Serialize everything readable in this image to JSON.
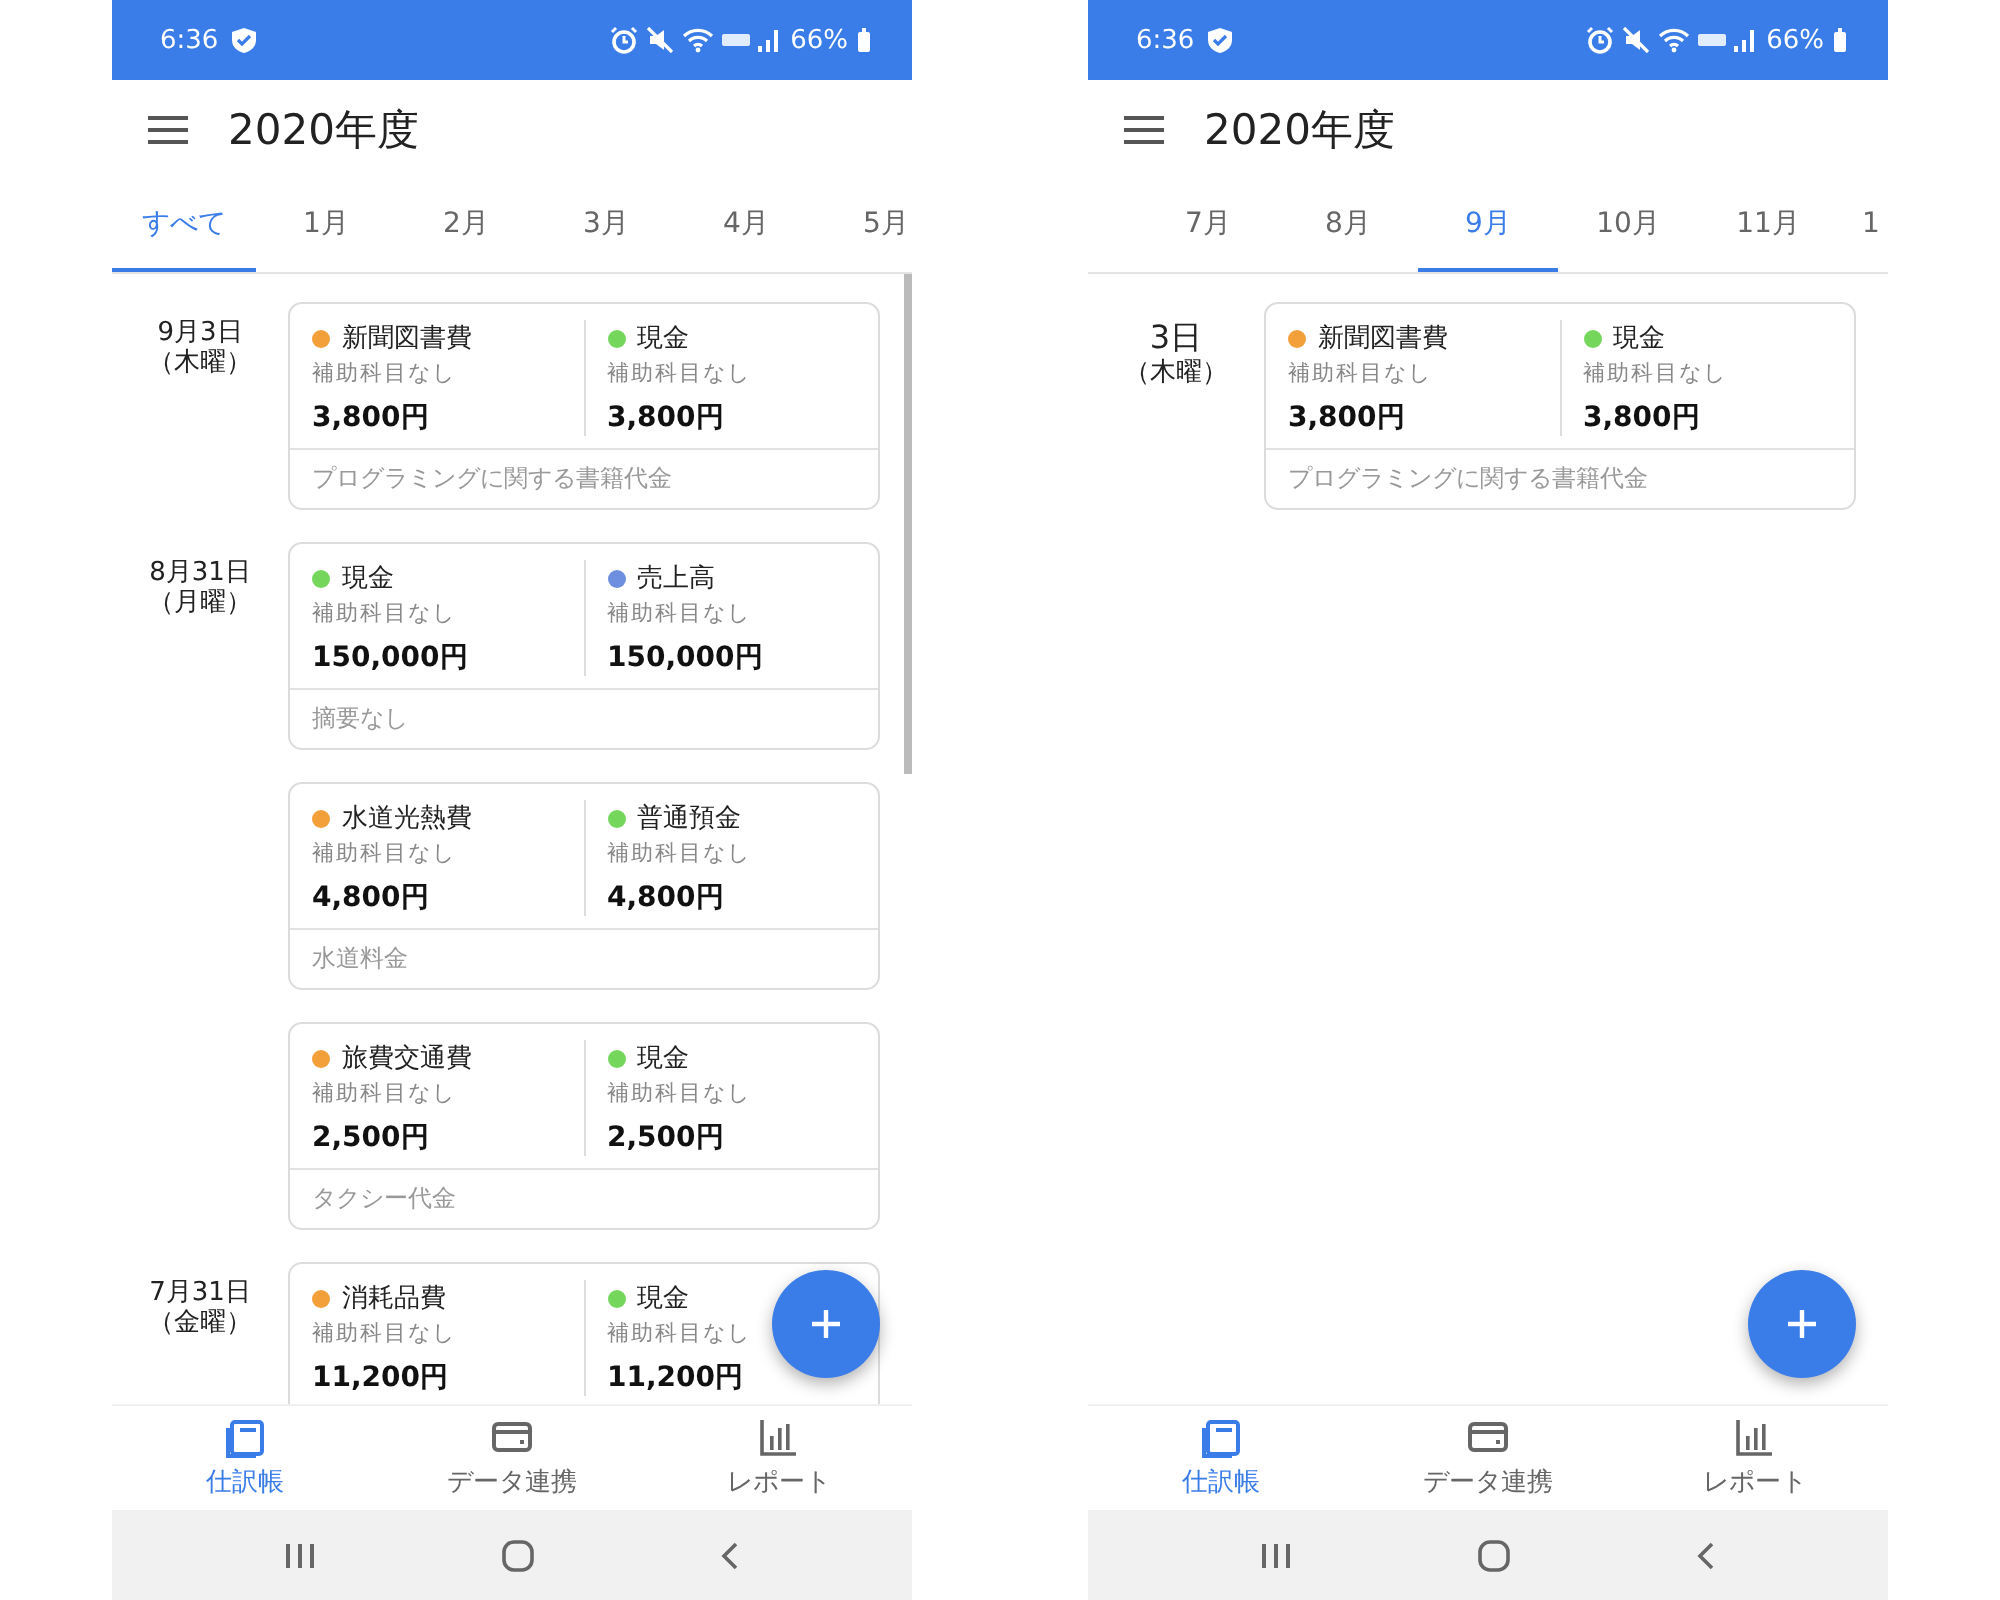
{
  "screens": [
    {
      "status_bar": {
        "time": "6:36",
        "battery": "66%"
      },
      "title": "2020年度",
      "tabs": [
        {
          "label": "すべて",
          "selected": true
        },
        {
          "label": "1月",
          "selected": false
        },
        {
          "label": "2月",
          "selected": false
        },
        {
          "label": "3月",
          "selected": false
        },
        {
          "label": "4月",
          "selected": false
        },
        {
          "label": "5月",
          "selected": false
        }
      ],
      "days": [
        {
          "date": "9月3日",
          "weekday": "（木曜）",
          "entries": [
            {
              "debit": {
                "account": "新聞図書費",
                "color": "#f4a03a",
                "sub": "補助科目なし",
                "amount": "3,800円"
              },
              "credit": {
                "account": "現金",
                "color": "#74d65a",
                "sub": "補助科目なし",
                "amount": "3,800円"
              },
              "memo": "プログラミングに関する書籍代金"
            }
          ]
        },
        {
          "date": "8月31日",
          "weekday": "（月曜）",
          "entries": [
            {
              "debit": {
                "account": "現金",
                "color": "#74d65a",
                "sub": "補助科目なし",
                "amount": "150,000円"
              },
              "credit": {
                "account": "売上高",
                "color": "#6e8fe0",
                "sub": "補助科目なし",
                "amount": "150,000円"
              },
              "memo": "摘要なし"
            },
            {
              "debit": {
                "account": "水道光熱費",
                "color": "#f4a03a",
                "sub": "補助科目なし",
                "amount": "4,800円"
              },
              "credit": {
                "account": "普通預金",
                "color": "#74d65a",
                "sub": "補助科目なし",
                "amount": "4,800円"
              },
              "memo": "水道料金"
            },
            {
              "debit": {
                "account": "旅費交通費",
                "color": "#f4a03a",
                "sub": "補助科目なし",
                "amount": "2,500円"
              },
              "credit": {
                "account": "現金",
                "color": "#74d65a",
                "sub": "補助科目なし",
                "amount": "2,500円"
              },
              "memo": "タクシー代金"
            }
          ]
        },
        {
          "date": "7月31日",
          "weekday": "（金曜）",
          "entries": [
            {
              "debit": {
                "account": "消耗品費",
                "color": "#f4a03a",
                "sub": "補助科目なし",
                "amount": "11,200円"
              },
              "credit": {
                "account": "現金",
                "color": "#74d65a",
                "sub": "補助科目なし",
                "amount": "11,200円"
              }
            }
          ]
        }
      ],
      "bottom_nav": [
        {
          "label": "仕訳帳",
          "selected": true
        },
        {
          "label": "データ連携",
          "selected": false
        },
        {
          "label": "レポート",
          "selected": false
        }
      ]
    },
    {
      "status_bar": {
        "time": "6:36",
        "battery": "66%"
      },
      "title": "2020年度",
      "tabs": [
        {
          "label": "7月",
          "selected": false
        },
        {
          "label": "8月",
          "selected": false
        },
        {
          "label": "9月",
          "selected": true
        },
        {
          "label": "10月",
          "selected": false
        },
        {
          "label": "11月",
          "selected": false
        },
        {
          "label": "1",
          "selected": false
        }
      ],
      "days": [
        {
          "date": "3日",
          "weekday": "（木曜）",
          "entries": [
            {
              "debit": {
                "account": "新聞図書費",
                "color": "#f4a03a",
                "sub": "補助科目なし",
                "amount": "3,800円"
              },
              "credit": {
                "account": "現金",
                "color": "#74d65a",
                "sub": "補助科目なし",
                "amount": "3,800円"
              },
              "memo": "プログラミングに関する書籍代金"
            }
          ]
        }
      ],
      "bottom_nav": [
        {
          "label": "仕訳帳",
          "selected": true
        },
        {
          "label": "データ連携",
          "selected": false
        },
        {
          "label": "レポート",
          "selected": false
        }
      ]
    }
  ]
}
